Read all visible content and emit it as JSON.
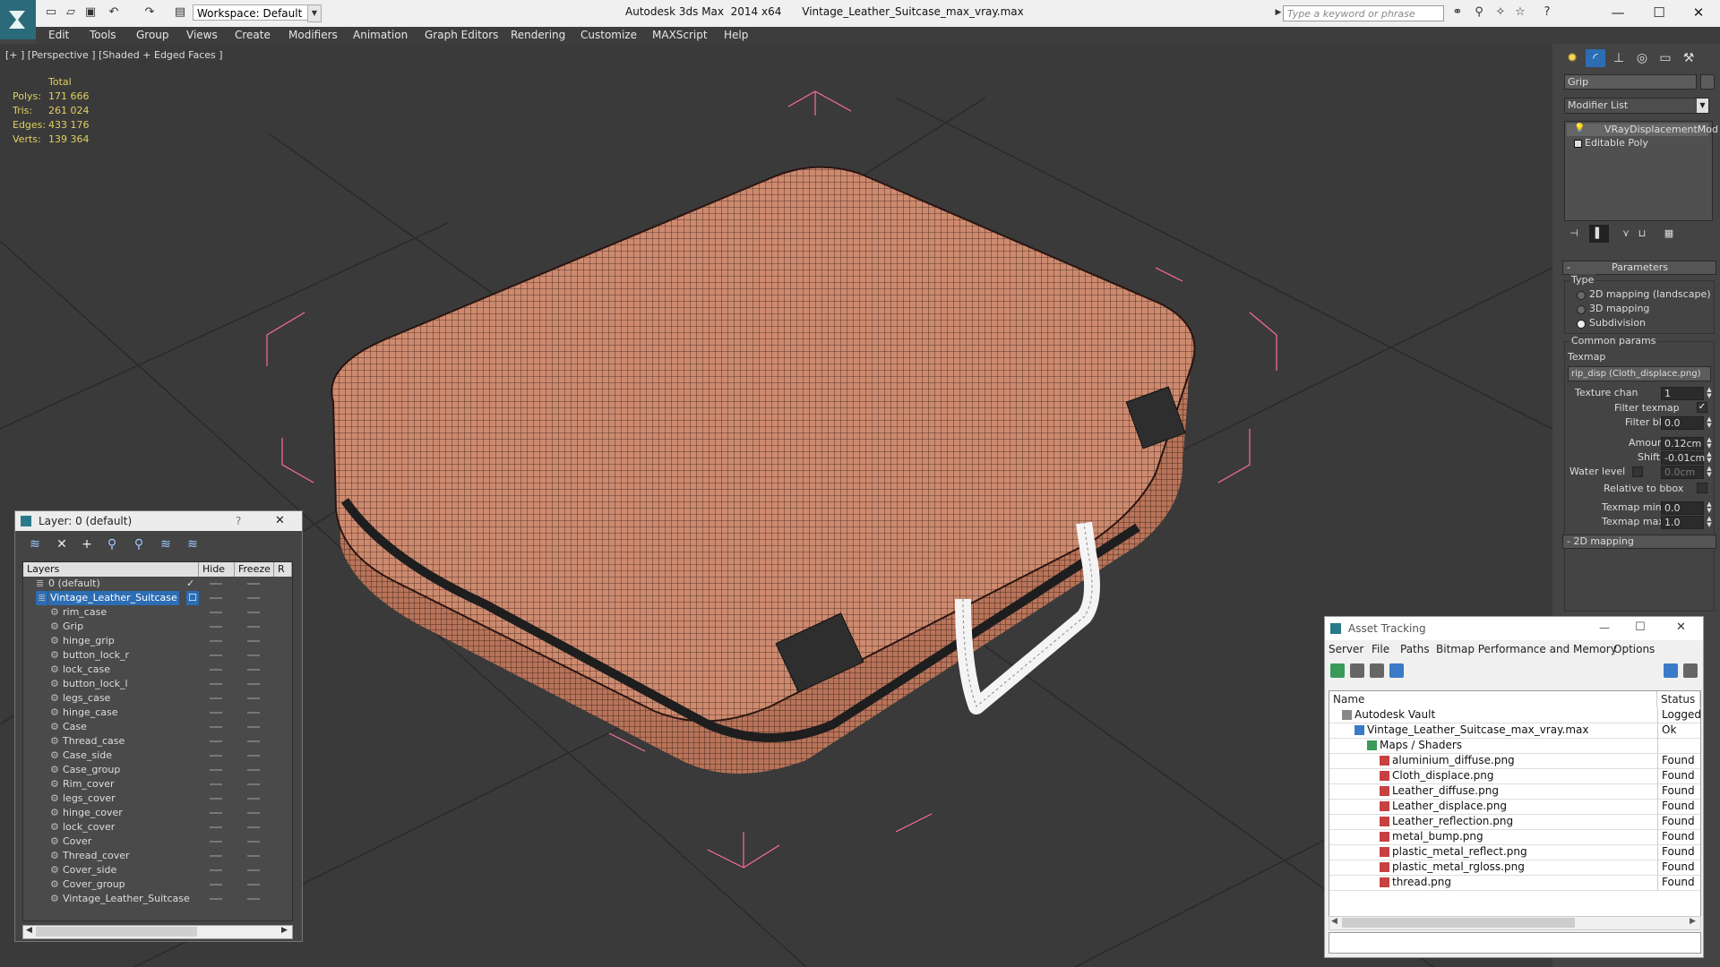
{
  "titlebar": {
    "workspace_label": "Workspace: Default",
    "title_app": "Autodesk 3ds Max  2014 x64",
    "title_file": "Vintage_Leather_Suitcase_max_vray.max",
    "search_placeholder": "Type a keyword or phrase",
    "minimize": "—",
    "maximize": "☐",
    "close": "✕"
  },
  "menubar": [
    "Edit",
    "Tools",
    "Group",
    "Views",
    "Create",
    "Modifiers",
    "Animation",
    "Graph Editors",
    "Rendering",
    "Customize",
    "MAXScript",
    "Help"
  ],
  "viewport": {
    "label": "[+ ] [Perspective ] [Shaded + Edged Faces ]",
    "stats": {
      "header": "Total",
      "rows": [
        {
          "k": "Polys:",
          "v": "171 666"
        },
        {
          "k": "Tris:",
          "v": "261 024"
        },
        {
          "k": "Edges:",
          "v": "433 176"
        },
        {
          "k": "Verts:",
          "v": "139 364"
        }
      ]
    }
  },
  "layer_panel": {
    "title": "Layer: 0 (default)",
    "help": "?",
    "close": "✕",
    "col_layers": "Layers",
    "col_hide": "Hide",
    "col_freeze": "Freeze",
    "col_r": "R",
    "rows": [
      {
        "name": "0 (default)",
        "indent": 0,
        "check": "✓"
      },
      {
        "name": "Vintage_Leather_Suitcase",
        "indent": 0,
        "check": "☐",
        "selected": true
      },
      {
        "name": "rim_case",
        "indent": 1
      },
      {
        "name": "Grip",
        "indent": 1
      },
      {
        "name": "hinge_grip",
        "indent": 1
      },
      {
        "name": "button_lock_r",
        "indent": 1
      },
      {
        "name": "lock_case",
        "indent": 1
      },
      {
        "name": "button_lock_l",
        "indent": 1
      },
      {
        "name": "legs_case",
        "indent": 1
      },
      {
        "name": "hinge_case",
        "indent": 1
      },
      {
        "name": "Case",
        "indent": 1
      },
      {
        "name": "Thread_case",
        "indent": 1
      },
      {
        "name": "Case_side",
        "indent": 1
      },
      {
        "name": "Case_group",
        "indent": 1
      },
      {
        "name": "Rim_cover",
        "indent": 1
      },
      {
        "name": "legs_cover",
        "indent": 1
      },
      {
        "name": "hinge_cover",
        "indent": 1
      },
      {
        "name": "lock_cover",
        "indent": 1
      },
      {
        "name": "Cover",
        "indent": 1
      },
      {
        "name": "Thread_cover",
        "indent": 1
      },
      {
        "name": "Cover_side",
        "indent": 1
      },
      {
        "name": "Cover_group",
        "indent": 1
      },
      {
        "name": "Vintage_Leather_Suitcase",
        "indent": 1
      }
    ]
  },
  "command_panel": {
    "object_name": "Grip",
    "modifier_list": "Modifier List",
    "stack": [
      "VRayDisplacementMod",
      "Editable Poly"
    ],
    "rollout_title": "Parameters",
    "type_label": "Type",
    "type_options": [
      "2D mapping (landscape)",
      "3D mapping",
      "Subdivision"
    ],
    "type_selected": 2,
    "common_label": "Common params",
    "texmap_label": "Texmap",
    "texmap_value": "rip_disp (Cloth_displace.png)",
    "texture_chan_label": "Texture chan",
    "texture_chan_value": "1",
    "filter_texmap_label": "Filter texmap",
    "filter_blur_label": "Filter blur",
    "filter_blur_value": "0.0",
    "amount_label": "Amount",
    "amount_value": "0.12cm",
    "shift_label": "Shift",
    "shift_value": "-0.01cm",
    "water_label": "Water level",
    "water_value": "0.0cm",
    "relative_label": "Relative to bbox",
    "texmap_min_label": "Texmap min",
    "texmap_min_value": "0.0",
    "texmap_max_label": "Texmap max",
    "texmap_max_value": "1.0",
    "next_rollout": "2D mapping"
  },
  "asset_panel": {
    "title": "Asset Tracking",
    "minimize": "—",
    "maximize": "☐",
    "close": "✕",
    "menu": [
      "Server",
      "File",
      "Paths",
      "Bitmap Performance and Memory",
      "Options"
    ],
    "col_name": "Name",
    "col_status": "Status",
    "rows": [
      {
        "name": "Autodesk Vault",
        "status": "Logged O",
        "indent": 0,
        "icon": "vault"
      },
      {
        "name": "Vintage_Leather_Suitcase_max_vray.max",
        "status": "Ok",
        "indent": 1,
        "icon": "max"
      },
      {
        "name": "Maps / Shaders",
        "status": "",
        "indent": 2,
        "icon": "folder"
      },
      {
        "name": "aluminium_diffuse.png",
        "status": "Found",
        "indent": 3,
        "icon": "png"
      },
      {
        "name": "Cloth_displace.png",
        "status": "Found",
        "indent": 3,
        "icon": "png"
      },
      {
        "name": "Leather_diffuse.png",
        "status": "Found",
        "indent": 3,
        "icon": "png"
      },
      {
        "name": "Leather_displace.png",
        "status": "Found",
        "indent": 3,
        "icon": "png"
      },
      {
        "name": "Leather_reflection.png",
        "status": "Found",
        "indent": 3,
        "icon": "png"
      },
      {
        "name": "metal_bump.png",
        "status": "Found",
        "indent": 3,
        "icon": "png"
      },
      {
        "name": "plastic_metal_reflect.png",
        "status": "Found",
        "indent": 3,
        "icon": "png"
      },
      {
        "name": "plastic_metal_rgloss.png",
        "status": "Found",
        "indent": 3,
        "icon": "png"
      },
      {
        "name": "thread.png",
        "status": "Found",
        "indent": 3,
        "icon": "png"
      }
    ]
  }
}
